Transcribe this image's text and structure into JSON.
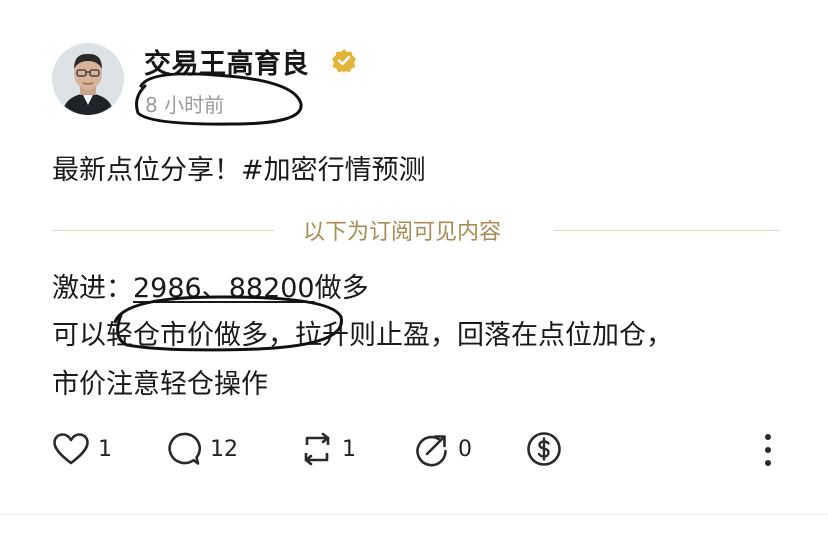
{
  "post": {
    "author": {
      "name": "交易王高育良",
      "verified": true,
      "badge_color": "#e2b53a"
    },
    "time": "8 小时前",
    "title": "最新点位分享！#加密行情预测",
    "subscriber_divider": "以下为订阅可见内容",
    "body": {
      "line1_prefix": "激进：",
      "line1_prices": "2986、88200",
      "line1_suffix": "做多",
      "line2": "可以轻仓市价做多，拉升则止盈，回落在点位加仓，",
      "line3": "市价注意轻仓操作"
    },
    "actions": {
      "like_count": "1",
      "comment_count": "12",
      "repost_count": "1",
      "share_count": "0"
    }
  }
}
